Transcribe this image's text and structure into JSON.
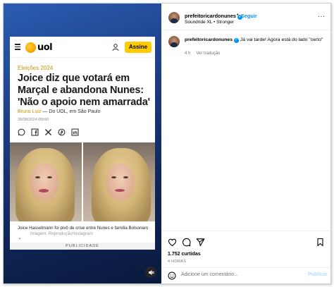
{
  "post": {
    "username": "prefeitoricardonunes",
    "follow_label": "Seguir",
    "separator": "•",
    "audio": "Soundride XL • Stronger",
    "caption": "Já vai tarde! Agora está do lado \"certo\"",
    "caption_age": "4 h",
    "see_translation": "Ver tradução",
    "likes": "1.752 curtidas",
    "timestamp": "4 HORAS",
    "comment_placeholder": "Adicione um comentário...",
    "publish_label": "Publicar"
  },
  "article": {
    "logo_text": "uol",
    "subscribe_label": "Assine",
    "section": "Eleições 2024",
    "headline": "Joice diz que votará em Marçal e abandona Nunes: 'Não o apoio nem amarrada'",
    "author": "Bruno Luiz",
    "byline_rest": " — Do UOL, em São Paulo",
    "date": "28/08/2024 05h50",
    "photo_caption": "Joice Hasselmann foi pivô de crise entre Nunes e família Bolsonaro",
    "photo_credit": "Imagem: Reprodução/Instagram",
    "ad_label": "PUBLICIDADE"
  },
  "colors": {
    "accent": "#0095f6",
    "uol_yellow": "#ffcc00",
    "section_gold": "#c79800",
    "media_bg": "#1d3f86"
  },
  "icons": [
    "menu-icon",
    "user-icon",
    "whatsapp-icon",
    "facebook-icon",
    "x-icon",
    "pinterest-icon",
    "linkedin-icon",
    "chevron-down-icon",
    "mute-icon",
    "verified-icon",
    "more-icon",
    "heart-icon",
    "comment-icon",
    "share-icon",
    "bookmark-icon",
    "emoji-icon"
  ]
}
